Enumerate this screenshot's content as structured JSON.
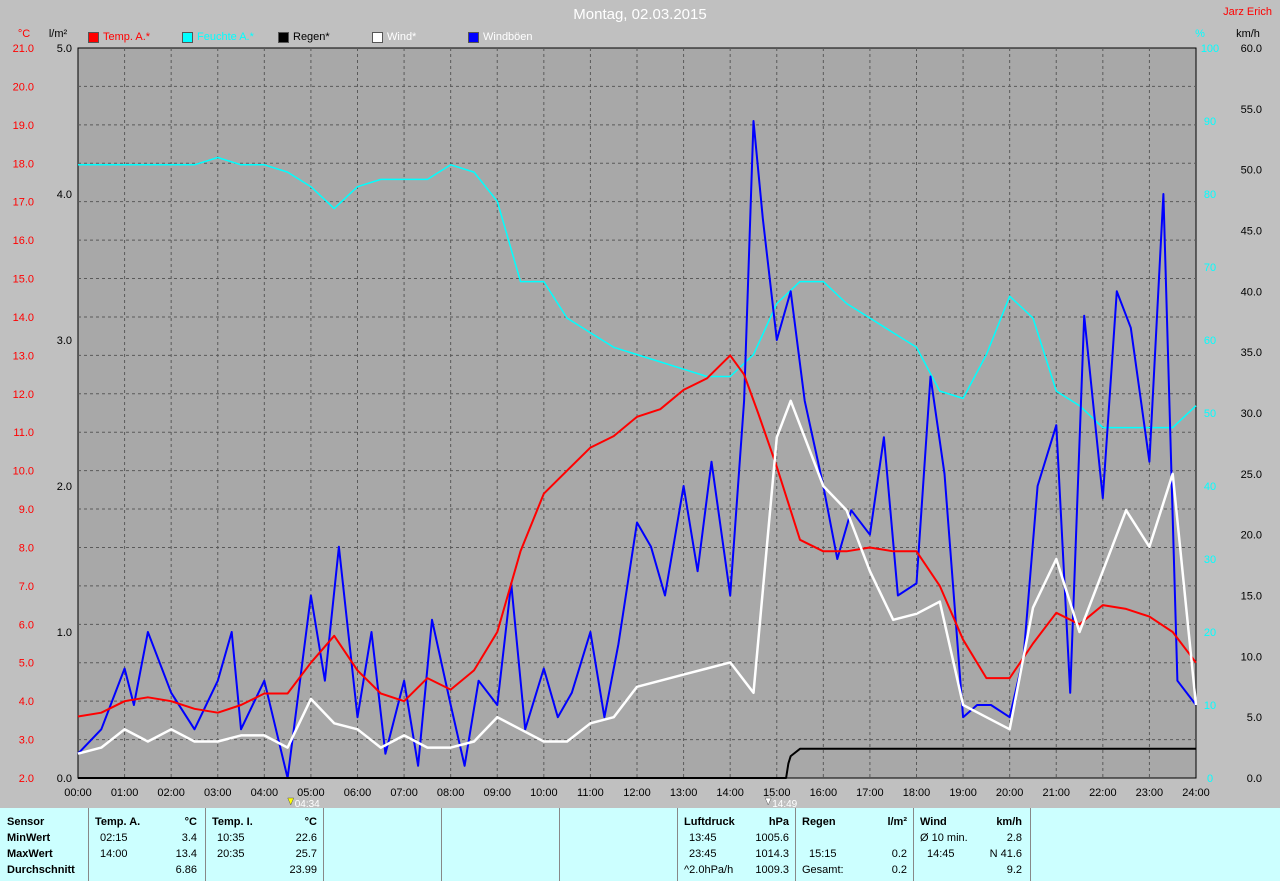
{
  "header": {
    "title": "Montag, 02.03.2015",
    "author": "Jarz Erich"
  },
  "axes": {
    "temp_unit": "°C",
    "rain_unit": "l/m²",
    "humidity_unit": "%",
    "wind_unit": "km/h",
    "temp_ticks": [
      "21.0",
      "20.0",
      "19.0",
      "18.0",
      "17.0",
      "16.0",
      "15.0",
      "14.0",
      "13.0",
      "12.0",
      "11.0",
      "10.0",
      "9.0",
      "8.0",
      "7.0",
      "6.0",
      "5.0",
      "4.0",
      "3.0",
      "2.0"
    ],
    "rain_ticks": [
      "5.0",
      "4.0",
      "3.0",
      "2.0",
      "1.0",
      "0.0"
    ],
    "humidity_ticks": [
      "100",
      "90",
      "80",
      "70",
      "60",
      "50",
      "40",
      "30",
      "20",
      "10",
      "0"
    ],
    "wind_ticks": [
      "60.0",
      "55.0",
      "50.0",
      "45.0",
      "40.0",
      "35.0",
      "30.0",
      "25.0",
      "20.0",
      "15.0",
      "10.0",
      "5.0",
      "0.0"
    ],
    "time_ticks": [
      "00:00",
      "01:00",
      "02:00",
      "03:00",
      "04:00",
      "05:00",
      "06:00",
      "07:00",
      "08:00",
      "09:00",
      "10:00",
      "11:00",
      "12:00",
      "13:00",
      "14:00",
      "15:00",
      "16:00",
      "17:00",
      "18:00",
      "19:00",
      "20:00",
      "21:00",
      "22:00",
      "23:00",
      "24:00"
    ],
    "sunrise": "04:34",
    "sunset": "14:49"
  },
  "legend": [
    {
      "label": "Temp. A.*",
      "color": "#ff0000"
    },
    {
      "label": "Feuchte A.*",
      "color": "#00ffff"
    },
    {
      "label": "Regen*",
      "color": "#000000"
    },
    {
      "label": "Wind*",
      "color": "#ffffff"
    },
    {
      "label": "Windböen",
      "color": "#0000ff"
    }
  ],
  "chart_data": {
    "type": "line",
    "title": "Montag, 02.03.2015",
    "xlim": [
      0,
      24
    ],
    "ylim_temp": [
      2,
      21
    ],
    "ylim_rain": [
      0,
      5
    ],
    "ylim_humidity": [
      0,
      100
    ],
    "ylim_wind": [
      0,
      60
    ],
    "grid": true,
    "legend_position": "top-left",
    "series": [
      {
        "name": "Temp. A.*",
        "axis": "temp",
        "color": "#ff0000",
        "x": [
          0,
          0.5,
          1,
          1.5,
          2,
          2.5,
          3,
          3.5,
          4,
          4.5,
          5,
          5.5,
          6,
          6.5,
          7,
          7.5,
          8,
          8.5,
          9,
          9.5,
          10,
          10.5,
          11,
          11.5,
          12,
          12.5,
          13,
          13.5,
          14,
          14.3,
          14.6,
          15,
          15.5,
          16,
          16.5,
          17,
          17.5,
          18,
          18.5,
          19,
          19.5,
          20,
          20.5,
          21,
          21.5,
          22,
          22.5,
          23,
          23.5,
          24
        ],
        "y": [
          3.6,
          3.7,
          4.0,
          4.1,
          4.0,
          3.8,
          3.7,
          3.9,
          4.2,
          4.2,
          5.0,
          5.7,
          4.8,
          4.2,
          4.0,
          4.6,
          4.3,
          4.8,
          5.8,
          7.9,
          9.4,
          10.0,
          10.6,
          10.9,
          11.4,
          11.6,
          12.1,
          12.4,
          13.0,
          12.5,
          11.5,
          10.1,
          8.2,
          7.9,
          7.9,
          8.0,
          7.9,
          7.9,
          7.0,
          5.6,
          4.6,
          4.6,
          5.5,
          6.3,
          6.0,
          6.5,
          6.4,
          6.2,
          5.8,
          5.0
        ]
      },
      {
        "name": "Feuchte A.*",
        "axis": "humidity",
        "color": "#00ffff",
        "x": [
          0,
          0.5,
          1,
          1.5,
          2,
          2.5,
          3,
          3.5,
          4,
          4.5,
          5,
          5.5,
          6,
          6.5,
          7,
          7.5,
          8,
          8.5,
          9,
          9.5,
          10,
          10.5,
          11,
          11.5,
          12,
          12.5,
          13,
          13.5,
          14,
          14.5,
          15,
          15.5,
          16,
          16.5,
          17,
          17.5,
          18,
          18.5,
          19,
          19.5,
          20,
          20.5,
          21,
          21.5,
          22,
          22.5,
          23,
          23.5,
          24
        ],
        "y": [
          84,
          84,
          84,
          84,
          84,
          84,
          85,
          84,
          84,
          83,
          81,
          78,
          81,
          82,
          82,
          82,
          84,
          83,
          79,
          68,
          68,
          63,
          61,
          59,
          58,
          57,
          56,
          55,
          55,
          58,
          65,
          68,
          68,
          65,
          63,
          61,
          59,
          53,
          52,
          58,
          66,
          63,
          53,
          51,
          48,
          48,
          48,
          48,
          51
        ]
      },
      {
        "name": "Regen*",
        "axis": "rain",
        "color": "#000000",
        "x": [
          0,
          15.2,
          15.25,
          15.3,
          15.5,
          15.8,
          16.2,
          16.8,
          24
        ],
        "y": [
          0,
          0,
          0.1,
          0.15,
          0.2,
          0.2,
          0.2,
          0.2,
          0.2
        ]
      },
      {
        "name": "Wind*",
        "axis": "wind",
        "color": "#ffffff",
        "x": [
          0,
          0.5,
          1,
          1.5,
          2,
          2.5,
          3,
          3.5,
          4,
          4.5,
          5,
          5.5,
          6,
          6.5,
          7,
          7.5,
          8,
          8.5,
          9,
          9.5,
          10,
          10.5,
          11,
          11.5,
          12,
          12.5,
          13,
          13.5,
          14,
          14.5,
          15,
          15.3,
          15.6,
          16,
          16.5,
          17,
          17.5,
          18,
          18.5,
          19,
          19.5,
          20,
          20.5,
          21,
          21.5,
          22,
          22.5,
          23,
          23.5,
          24
        ],
        "y": [
          2.0,
          2.5,
          4.0,
          3.0,
          4.0,
          3.0,
          3.0,
          3.5,
          3.5,
          2.5,
          6.5,
          4.5,
          4.0,
          2.5,
          3.5,
          2.5,
          2.5,
          3.0,
          5.0,
          4.0,
          3.0,
          3.0,
          4.5,
          5.0,
          7.5,
          8.0,
          8.5,
          9.0,
          9.5,
          7.0,
          28.0,
          31.0,
          28.0,
          24.0,
          22.0,
          17.0,
          13.0,
          13.5,
          14.5,
          6.0,
          5.0,
          4.0,
          14.0,
          18.0,
          12.0,
          17.0,
          22.0,
          19.0,
          25.0,
          6.0
        ]
      },
      {
        "name": "Windböen",
        "axis": "wind",
        "color": "#0000ff",
        "x": [
          0,
          0.5,
          1,
          1.2,
          1.5,
          2,
          2.5,
          3,
          3.3,
          3.5,
          4,
          4.5,
          5,
          5.3,
          5.6,
          6,
          6.3,
          6.6,
          7,
          7.3,
          7.6,
          8,
          8.3,
          8.6,
          9,
          9.3,
          9.6,
          10,
          10.3,
          10.6,
          11,
          11.3,
          11.6,
          12,
          12.3,
          12.6,
          13,
          13.3,
          13.6,
          14,
          14.3,
          14.5,
          14.7,
          15,
          15.3,
          15.6,
          16,
          16.3,
          16.6,
          17,
          17.3,
          17.6,
          18,
          18.3,
          18.6,
          19,
          19.3,
          19.6,
          20,
          20.3,
          20.6,
          21,
          21.3,
          21.6,
          22,
          22.3,
          22.6,
          23,
          23.3,
          23.6,
          24
        ],
        "y": [
          2,
          4,
          9,
          6,
          12,
          7,
          4,
          8,
          12,
          4,
          8,
          0,
          15,
          8,
          19,
          5,
          12,
          2,
          8,
          1,
          13,
          6,
          1,
          8,
          6,
          16,
          4,
          9,
          5,
          7,
          12,
          5,
          11,
          21,
          19,
          15,
          24,
          17,
          26,
          15,
          31,
          54,
          46,
          36,
          40,
          31,
          24,
          18,
          22,
          20,
          28,
          15,
          16,
          33,
          25,
          5,
          6,
          6,
          5,
          10,
          24,
          29,
          7,
          38,
          23,
          40,
          37,
          26,
          48,
          8,
          6
        ]
      }
    ]
  },
  "stats": {
    "headers": {
      "sensor": "Sensor",
      "temp_a": "Temp. A.",
      "temp_a_unit": "°C",
      "temp_i": "Temp. I.",
      "temp_i_unit": "°C",
      "pressure": "Luftdruck",
      "pressure_unit": "hPa",
      "rain": "Regen",
      "rain_unit": "l/m²",
      "wind": "Wind",
      "wind_unit": "km/h"
    },
    "rows": [
      "MinWert",
      "MaxWert",
      "Durchschnitt"
    ],
    "temp_a": [
      [
        "02:15",
        "3.4"
      ],
      [
        "14:00",
        "13.4"
      ],
      [
        "",
        "6.86"
      ]
    ],
    "temp_i": [
      [
        "10:35",
        "22.6"
      ],
      [
        "20:35",
        "25.7"
      ],
      [
        "",
        "23.99"
      ]
    ],
    "pressure": [
      [
        "13:45",
        "1005.6"
      ],
      [
        "23:45",
        "1014.3"
      ],
      [
        "^2.0hPa/h",
        "1009.3"
      ]
    ],
    "rain": [
      [
        "",
        ""
      ],
      [
        "15:15",
        "0.2"
      ],
      [
        "Gesamt:",
        "0.2"
      ]
    ],
    "wind": [
      [
        "Ø 10 min.",
        "2.8"
      ],
      [
        "14:45",
        "N 41.6"
      ],
      [
        "",
        "9.2"
      ]
    ]
  }
}
